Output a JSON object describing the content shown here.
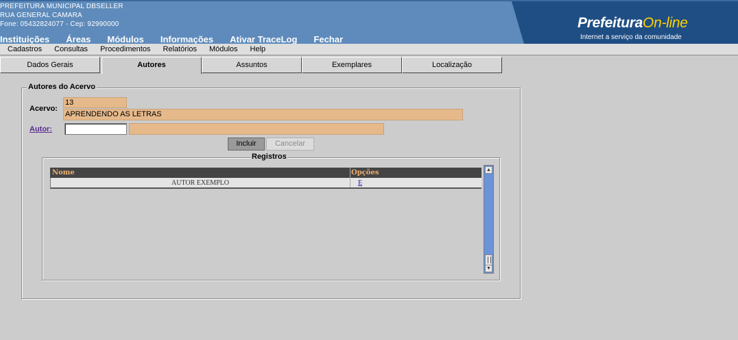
{
  "header": {
    "org_name": "PREFEITURA MUNICIPAL DBSELLER",
    "address": "RUA GENERAL CAMARA",
    "contact": "Fone: 05432824077  -  Cep: 92990000",
    "logo_prefix": "Prefeitura",
    "logo_suffix": "On-line",
    "logo_tagline": "Internet a serviço da comunidade",
    "menu": [
      "Instituições",
      "Áreas",
      "Módulos",
      "Informações",
      "Ativar TraceLog",
      "Fechar"
    ]
  },
  "menubar": [
    "Cadastros",
    "Consultas",
    "Procedimentos",
    "Relatórios",
    "Módulos",
    "Help"
  ],
  "tabs": [
    "Dados Gerais",
    "Autores",
    "Assuntos",
    "Exemplares",
    "Localização"
  ],
  "active_tab": "Autores",
  "form": {
    "legend": "Autores do Acervo",
    "acervo_label": "Acervo:",
    "acervo_code": "13",
    "acervo_title": "APRENDENDO AS LETRAS",
    "autor_label": "Autor:",
    "autor_code": "",
    "autor_name": "",
    "incluir_label": "Incluir",
    "cancelar_label": "Cancelar"
  },
  "registros": {
    "legend": "Registros",
    "columns": [
      "Nome",
      "Opções"
    ],
    "rows": [
      {
        "nome": "AUTOR EXEMPLO",
        "opcao": "E"
      }
    ]
  },
  "colors": {
    "header_bg": "#5e8bbb",
    "logo_bg": "#1f4e84",
    "field_bg": "#e6b98a",
    "grid_header_bg": "#444444",
    "grid_header_text": "#f0b070"
  }
}
